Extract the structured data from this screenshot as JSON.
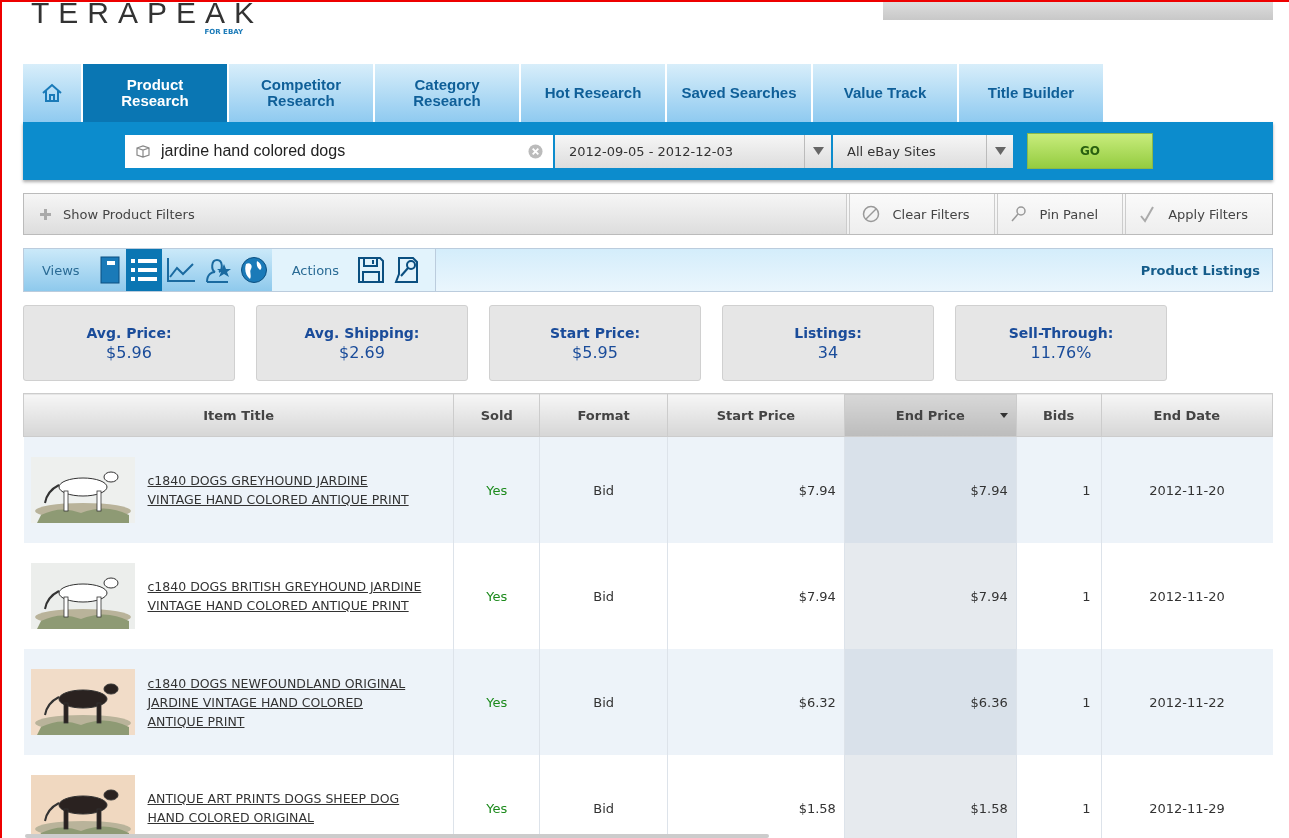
{
  "logo": {
    "name": "TERAPEAK",
    "tagline": "FOR EBAY"
  },
  "tabs": [
    {
      "kind": "home",
      "selected": false
    },
    {
      "label": "Product Research",
      "selected": true
    },
    {
      "label": "Competitor Research",
      "selected": false
    },
    {
      "label": "Category Research",
      "selected": false
    },
    {
      "label": "Hot Research",
      "selected": false
    },
    {
      "label": "Saved Searches",
      "selected": false
    },
    {
      "label": "Value Track",
      "selected": false
    },
    {
      "label": "Title Builder",
      "selected": false
    }
  ],
  "search": {
    "value": "jardine hand colored dogs",
    "date_range": "2012-09-05 - 2012-12-03",
    "site": "All eBay Sites",
    "button": "GO"
  },
  "filter_bar": {
    "toggle": "Show Product Filters",
    "buttons": [
      {
        "kind": "clear",
        "label": "Clear Filters"
      },
      {
        "kind": "pin",
        "label": "Pin Panel"
      },
      {
        "kind": "apply",
        "label": "Apply Filters"
      }
    ]
  },
  "views": {
    "label": "Views",
    "items": [
      {
        "kind": "notebook",
        "selected": false
      },
      {
        "kind": "list",
        "selected": true
      },
      {
        "kind": "chart",
        "selected": false
      },
      {
        "kind": "person",
        "selected": false
      },
      {
        "kind": "globe",
        "selected": false
      }
    ],
    "actions_label": "Actions",
    "actions": [
      {
        "kind": "save"
      },
      {
        "kind": "pin"
      }
    ],
    "title": "Product Listings"
  },
  "stats": [
    {
      "label": "Avg. Price:",
      "value": "$5.96"
    },
    {
      "label": "Avg. Shipping:",
      "value": "$2.69"
    },
    {
      "label": "Start Price:",
      "value": "$5.95"
    },
    {
      "label": "Listings:",
      "value": "34"
    },
    {
      "label": "Sell-Through:",
      "value": "11.76%"
    }
  ],
  "table": {
    "columns": [
      {
        "label": "Item Title",
        "selected": false
      },
      {
        "label": "Sold",
        "selected": false
      },
      {
        "label": "Format",
        "selected": false
      },
      {
        "label": "Start Price",
        "selected": false
      },
      {
        "label": "End Price",
        "selected": true
      },
      {
        "label": "Bids",
        "selected": false
      },
      {
        "label": "End Date",
        "selected": false
      }
    ],
    "rows": [
      {
        "kind": "picture",
        "title": "c1840 DOGS GREYHOUND JARDINE VINTAGE HAND COLORED ANTIQUE PRINT",
        "sold": "Yes",
        "format": "Bid",
        "start_price": "$7.94",
        "end_price": "$7.94",
        "bids": "1",
        "end_date": "2012-11-20"
      },
      {
        "kind": "picture",
        "title": "c1840 DOGS BRITISH GREYHOUND JARDINE VINTAGE HAND COLORED ANTIQUE PRINT",
        "sold": "Yes",
        "format": "Bid",
        "start_price": "$7.94",
        "end_price": "$7.94",
        "bids": "1",
        "end_date": "2012-11-20"
      },
      {
        "kind": "picture",
        "title": "c1840 DOGS NEWFOUNDLAND ORIGINAL JARDINE VINTAGE HAND COLORED ANTIQUE PRINT",
        "sold": "Yes",
        "format": "Bid",
        "start_price": "$6.32",
        "end_price": "$6.36",
        "bids": "1",
        "end_date": "2012-11-22"
      },
      {
        "kind": "picture",
        "title": "ANTIQUE ART PRINTS DOGS SHEEP DOG HAND COLORED ORIGINAL",
        "sold": "Yes",
        "format": "Bid",
        "start_price": "$1.58",
        "end_price": "$1.58",
        "bids": "1",
        "end_date": "2012-11-29"
      }
    ]
  }
}
